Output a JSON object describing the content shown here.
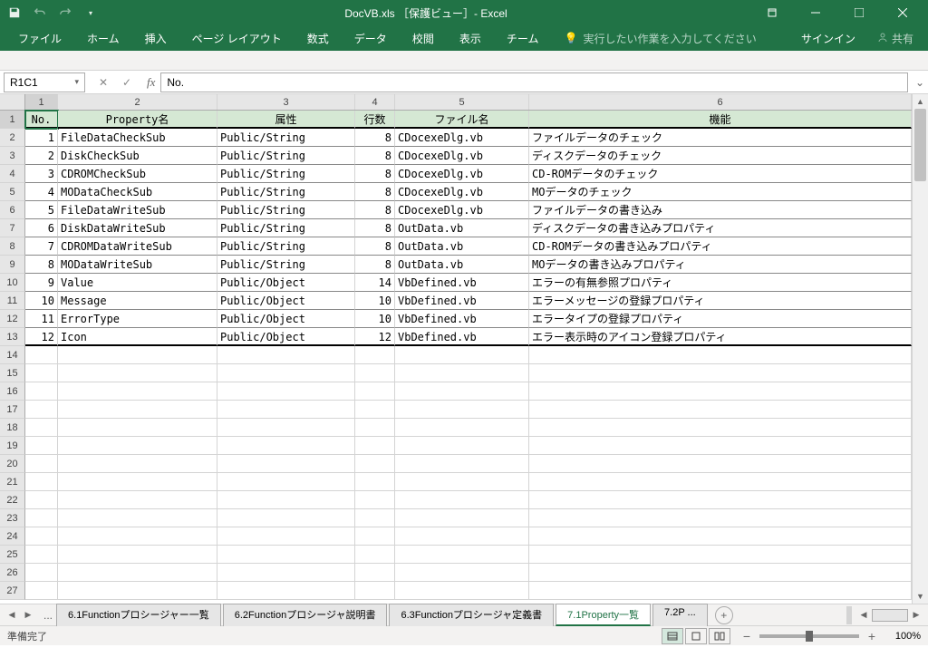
{
  "titlebar": {
    "title": "DocVB.xls ［保護ビュー］- Excel"
  },
  "ribbon": {
    "tabs": [
      "ファイル",
      "ホーム",
      "挿入",
      "ページ レイアウト",
      "数式",
      "データ",
      "校閲",
      "表示",
      "チーム"
    ],
    "tell_me": "実行したい作業を入力してください",
    "signin": "サインイン",
    "share": "共有"
  },
  "formula_bar": {
    "name_box": "R1C1",
    "formula": "No."
  },
  "columns": [
    "1",
    "2",
    "3",
    "4",
    "5",
    "6"
  ],
  "headers": {
    "c1": "No.",
    "c2": "Property名",
    "c3": "属性",
    "c4": "行数",
    "c5": "ファイル名",
    "c6": "機能"
  },
  "rows": [
    {
      "no": "1",
      "prop": "FileDataCheckSub",
      "attr": "Public/String",
      "lines": "8",
      "file": "CDocexeDlg.vb",
      "func": "ファイルデータのチェック"
    },
    {
      "no": "2",
      "prop": "DiskCheckSub",
      "attr": "Public/String",
      "lines": "8",
      "file": "CDocexeDlg.vb",
      "func": "ディスクデータのチェック"
    },
    {
      "no": "3",
      "prop": "CDROMCheckSub",
      "attr": "Public/String",
      "lines": "8",
      "file": "CDocexeDlg.vb",
      "func": "CD-ROMデータのチェック"
    },
    {
      "no": "4",
      "prop": "MODataCheckSub",
      "attr": "Public/String",
      "lines": "8",
      "file": "CDocexeDlg.vb",
      "func": "MOデータのチェック"
    },
    {
      "no": "5",
      "prop": "FileDataWriteSub",
      "attr": "Public/String",
      "lines": "8",
      "file": "CDocexeDlg.vb",
      "func": "ファイルデータの書き込み"
    },
    {
      "no": "6",
      "prop": "DiskDataWriteSub",
      "attr": "Public/String",
      "lines": "8",
      "file": "OutData.vb",
      "func": "ディスクデータの書き込みプロパティ"
    },
    {
      "no": "7",
      "prop": "CDROMDataWriteSub",
      "attr": "Public/String",
      "lines": "8",
      "file": "OutData.vb",
      "func": "CD-ROMデータの書き込みプロパティ"
    },
    {
      "no": "8",
      "prop": "MODataWriteSub",
      "attr": "Public/String",
      "lines": "8",
      "file": "OutData.vb",
      "func": "MOデータの書き込みプロパティ"
    },
    {
      "no": "9",
      "prop": "Value",
      "attr": "Public/Object",
      "lines": "14",
      "file": "VbDefined.vb",
      "func": "エラーの有無参照プロパティ"
    },
    {
      "no": "10",
      "prop": "Message",
      "attr": "Public/Object",
      "lines": "10",
      "file": "VbDefined.vb",
      "func": "エラーメッセージの登録プロパティ"
    },
    {
      "no": "11",
      "prop": "ErrorType",
      "attr": "Public/Object",
      "lines": "10",
      "file": "VbDefined.vb",
      "func": "エラータイプの登録プロパティ"
    },
    {
      "no": "12",
      "prop": "Icon",
      "attr": "Public/Object",
      "lines": "12",
      "file": "VbDefined.vb",
      "func": "エラー表示時のアイコン登録プロパティ"
    }
  ],
  "empty_rows": [
    "14",
    "15",
    "16",
    "17",
    "18",
    "19",
    "20",
    "21",
    "22",
    "23",
    "24",
    "25",
    "26",
    "27"
  ],
  "sheet_tabs": {
    "items": [
      "6.1Functionプロシージャー一覧",
      "6.2Functionプロシージャ説明書",
      "6.3Functionプロシージャ定義書",
      "7.1Property一覧",
      "7.2P ..."
    ],
    "active_index": 3
  },
  "status": {
    "ready": "準備完了",
    "zoom": "100%"
  }
}
